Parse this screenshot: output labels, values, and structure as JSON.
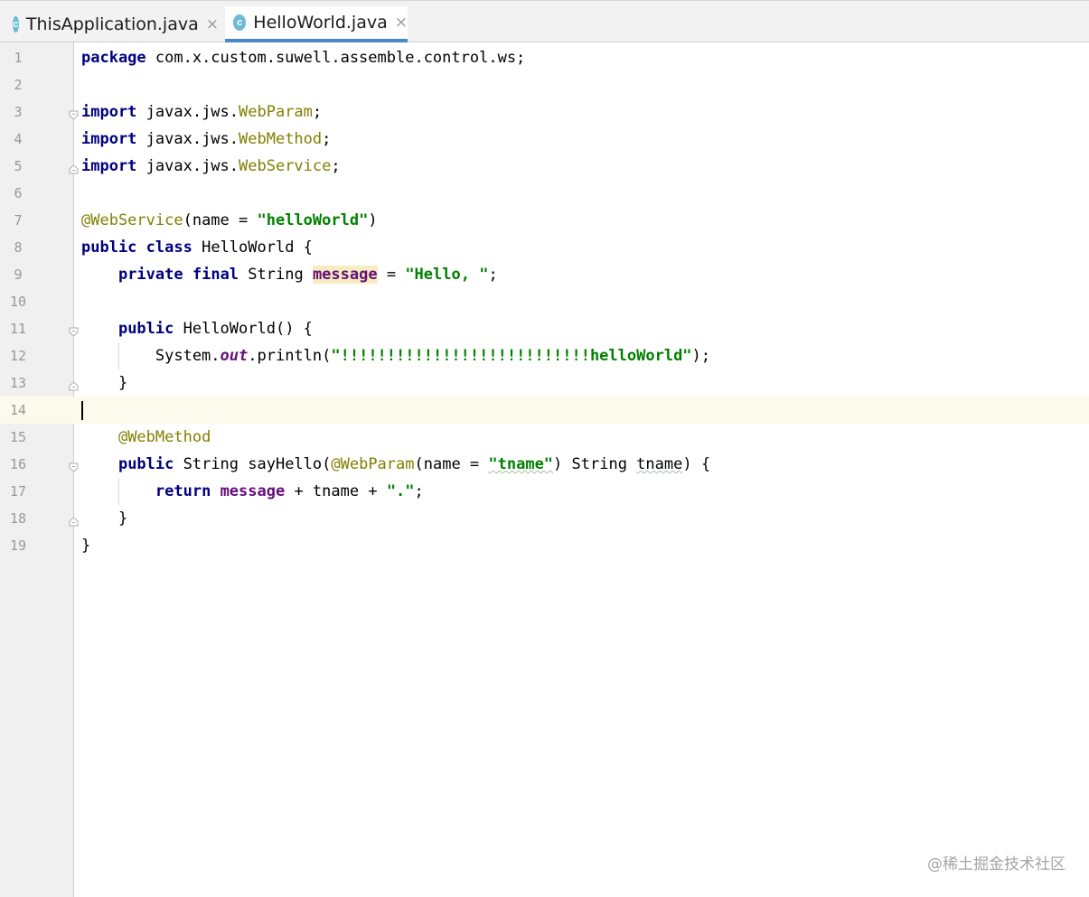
{
  "tabs": [
    {
      "label": "ThisApplication.java",
      "icon": "java-class-icon",
      "icon_letter": "c",
      "close": "×"
    },
    {
      "label": "HelloWorld.java",
      "icon": "java-class-icon",
      "icon_letter": "c",
      "close": "×"
    }
  ],
  "active_tab_index": 1,
  "current_line": 14,
  "colors": {
    "keyword": "#000080",
    "annotation": "#808000",
    "string": "#008000",
    "field": "#660e7a",
    "line_number": "#999999",
    "current_line_bg": "#fcfaed",
    "active_tab_underline": "#4a88c7"
  },
  "lines": [
    {
      "n": "1",
      "fold": "",
      "guide": false,
      "tokens": [
        [
          "kw",
          "package"
        ],
        [
          "p",
          " com.x.custom.suwell.assemble.control.ws;"
        ]
      ]
    },
    {
      "n": "2",
      "fold": "",
      "guide": false,
      "tokens": []
    },
    {
      "n": "3",
      "fold": "start",
      "guide": false,
      "tokens": [
        [
          "kw",
          "import"
        ],
        [
          "p",
          " javax.jws."
        ],
        [
          "ann",
          "WebParam"
        ],
        [
          "p",
          ";"
        ]
      ]
    },
    {
      "n": "4",
      "fold": "",
      "guide": false,
      "tokens": [
        [
          "kw",
          "import"
        ],
        [
          "p",
          " javax.jws."
        ],
        [
          "ann",
          "WebMethod"
        ],
        [
          "p",
          ";"
        ]
      ]
    },
    {
      "n": "5",
      "fold": "end",
      "guide": false,
      "tokens": [
        [
          "kw",
          "import"
        ],
        [
          "p",
          " javax.jws."
        ],
        [
          "ann",
          "WebService"
        ],
        [
          "p",
          ";"
        ]
      ]
    },
    {
      "n": "6",
      "fold": "",
      "guide": false,
      "tokens": []
    },
    {
      "n": "7",
      "fold": "",
      "guide": false,
      "tokens": [
        [
          "ann",
          "@WebService"
        ],
        [
          "p",
          "(name = "
        ],
        [
          "str",
          "\"helloWorld\""
        ],
        [
          "p",
          ")"
        ]
      ]
    },
    {
      "n": "8",
      "fold": "",
      "guide": false,
      "tokens": [
        [
          "kw",
          "public"
        ],
        [
          "p",
          " "
        ],
        [
          "kw",
          "class"
        ],
        [
          "p",
          " HelloWorld {"
        ]
      ]
    },
    {
      "n": "9",
      "fold": "",
      "guide": false,
      "tokens": [
        [
          "p",
          "    "
        ],
        [
          "kw",
          "private"
        ],
        [
          "p",
          " "
        ],
        [
          "kw",
          "final"
        ],
        [
          "p",
          " String "
        ],
        [
          "fld hl",
          "message"
        ],
        [
          "p",
          " = "
        ],
        [
          "str",
          "\"Hello, \""
        ],
        [
          "p",
          ";"
        ]
      ]
    },
    {
      "n": "10",
      "fold": "",
      "guide": false,
      "tokens": []
    },
    {
      "n": "11",
      "fold": "start",
      "guide": false,
      "tokens": [
        [
          "p",
          "    "
        ],
        [
          "kw",
          "public"
        ],
        [
          "p",
          " HelloWorld() {"
        ]
      ]
    },
    {
      "n": "12",
      "fold": "",
      "guide": true,
      "tokens": [
        [
          "p",
          "        System."
        ],
        [
          "sfld",
          "out"
        ],
        [
          "p",
          ".println("
        ],
        [
          "str",
          "\"!!!!!!!!!!!!!!!!!!!!!!!!!!!helloWorld\""
        ],
        [
          "p",
          ");"
        ]
      ]
    },
    {
      "n": "13",
      "fold": "end",
      "guide": false,
      "tokens": [
        [
          "p",
          "    }"
        ]
      ]
    },
    {
      "n": "14",
      "fold": "",
      "guide": false,
      "tokens": []
    },
    {
      "n": "15",
      "fold": "",
      "guide": false,
      "tokens": [
        [
          "p",
          "    "
        ],
        [
          "ann",
          "@WebMethod"
        ]
      ]
    },
    {
      "n": "16",
      "fold": "start",
      "guide": false,
      "tokens": [
        [
          "p",
          "    "
        ],
        [
          "kw",
          "public"
        ],
        [
          "p",
          " String sayHello("
        ],
        [
          "ann",
          "@WebParam"
        ],
        [
          "p",
          "(name = "
        ],
        [
          "str wavy",
          "\"tname\""
        ],
        [
          "p",
          ") String "
        ],
        [
          "wavy",
          "tname"
        ],
        [
          "p",
          ") {"
        ]
      ]
    },
    {
      "n": "17",
      "fold": "",
      "guide": true,
      "tokens": [
        [
          "p",
          "        "
        ],
        [
          "kw",
          "return"
        ],
        [
          "p",
          " "
        ],
        [
          "fld",
          "message"
        ],
        [
          "p",
          " + tname + "
        ],
        [
          "str",
          "\".\""
        ],
        [
          "p",
          ";"
        ]
      ]
    },
    {
      "n": "18",
      "fold": "end",
      "guide": false,
      "tokens": [
        [
          "p",
          "    }"
        ]
      ]
    },
    {
      "n": "19",
      "fold": "",
      "guide": false,
      "tokens": [
        [
          "p",
          "}"
        ]
      ]
    }
  ],
  "watermark": "@稀土掘金技术社区"
}
